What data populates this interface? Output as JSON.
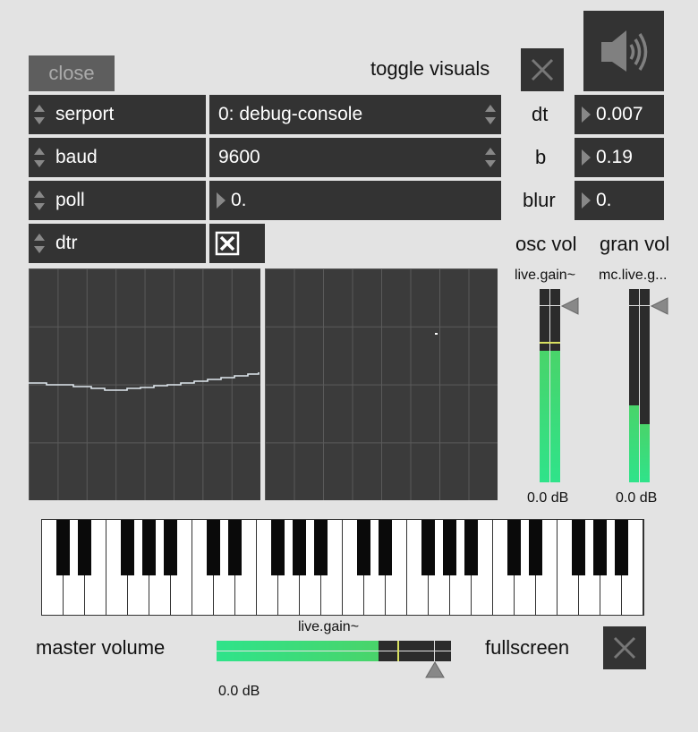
{
  "top": {
    "close_label": "close",
    "toggle_visuals_label": "toggle visuals"
  },
  "serial": {
    "serport_label": "serport",
    "serport_value": "0: debug-console",
    "baud_label": "baud",
    "baud_value": "9600",
    "poll_label": "poll",
    "poll_value": "0.",
    "dtr_label": "dtr",
    "dtr_checked": true
  },
  "params": {
    "dt_label": "dt",
    "dt_value": "0.007",
    "b_label": "b",
    "b_value": "0.19",
    "blur_label": "blur",
    "blur_value": "0."
  },
  "meters": {
    "osc_label": "osc vol",
    "gran_label": "gran vol",
    "osc_object": "live.gain~",
    "gran_object": "mc.live.g...",
    "osc_db": "0.0 dB",
    "gran_db": "0.0 dB",
    "osc_levels": [
      0.68,
      0.68
    ],
    "gran_levels": [
      0.4,
      0.3
    ]
  },
  "master": {
    "label": "master volume",
    "object": "live.gain~",
    "db": "0.0 dB",
    "level": 0.69,
    "fullscreen_label": "fullscreen"
  },
  "colors": {
    "panel": "#333333",
    "meter_green": "#3fe07a",
    "background": "#e3e3e3"
  },
  "icons": {
    "speaker": "speaker-icon",
    "toggle_x": "close-x-icon",
    "fullscreen_x": "close-x-icon"
  }
}
